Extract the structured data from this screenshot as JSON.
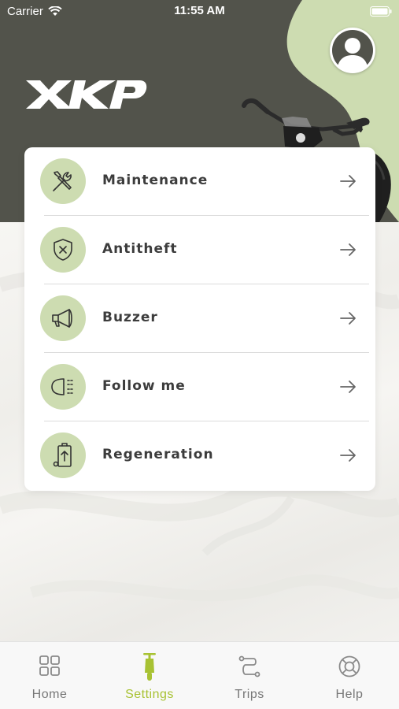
{
  "status_bar": {
    "carrier": "Carrier",
    "time": "11:55 AM"
  },
  "brand": {
    "logo_text": "XKP",
    "accent_color": "#cddcb1",
    "header_color": "#52534b",
    "active_tab_color": "#a8c233"
  },
  "menu": {
    "items": [
      {
        "label": "Maintenance",
        "icon": "tools-icon"
      },
      {
        "label": "Antitheft",
        "icon": "shield-icon"
      },
      {
        "label": "Buzzer",
        "icon": "megaphone-icon"
      },
      {
        "label": "Follow me",
        "icon": "headlight-icon"
      },
      {
        "label": "Regeneration",
        "icon": "battery-charge-icon"
      }
    ]
  },
  "tabbar": {
    "tabs": [
      {
        "label": "Home",
        "icon": "grid-icon",
        "active": false
      },
      {
        "label": "Settings",
        "icon": "scooter-icon",
        "active": true
      },
      {
        "label": "Trips",
        "icon": "route-icon",
        "active": false
      },
      {
        "label": "Help",
        "icon": "lifebuoy-icon",
        "active": false
      }
    ]
  }
}
